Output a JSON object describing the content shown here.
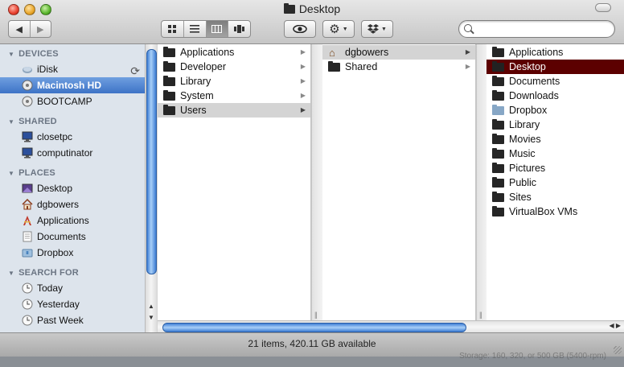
{
  "window": {
    "title": "Desktop"
  },
  "toolbar": {
    "nav": [
      "◀",
      "▶"
    ],
    "views": [
      "icon-view",
      "list-view",
      "column-view",
      "coverflow-view"
    ],
    "search": {
      "value": "",
      "placeholder": ""
    }
  },
  "sidebar": {
    "sections": [
      {
        "title": "DEVICES",
        "items": [
          {
            "label": "iDisk",
            "icon": "idisk-icon"
          },
          {
            "label": "Macintosh HD",
            "icon": "harddisk-icon",
            "selected": true
          },
          {
            "label": "BOOTCAMP",
            "icon": "harddisk-icon"
          }
        ]
      },
      {
        "title": "SHARED",
        "items": [
          {
            "label": "closetpc",
            "icon": "computer-icon"
          },
          {
            "label": "computinator",
            "icon": "computer-icon"
          }
        ]
      },
      {
        "title": "PLACES",
        "items": [
          {
            "label": "Desktop",
            "icon": "desktop-icon"
          },
          {
            "label": "dgbowers",
            "icon": "home-icon"
          },
          {
            "label": "Applications",
            "icon": "applications-icon"
          },
          {
            "label": "Documents",
            "icon": "documents-icon"
          },
          {
            "label": "Dropbox",
            "icon": "dropbox-icon"
          }
        ]
      },
      {
        "title": "SEARCH FOR",
        "items": [
          {
            "label": "Today",
            "icon": "clock-icon"
          },
          {
            "label": "Yesterday",
            "icon": "clock-icon"
          },
          {
            "label": "Past Week",
            "icon": "clock-icon"
          }
        ]
      }
    ]
  },
  "columns": [
    {
      "items": [
        {
          "label": "Applications"
        },
        {
          "label": "Developer"
        },
        {
          "label": "Library"
        },
        {
          "label": "System"
        },
        {
          "label": "Users",
          "state": "highlighted"
        }
      ]
    },
    {
      "items": [
        {
          "label": "dgbowers",
          "state": "highlighted",
          "icon": "home"
        },
        {
          "label": "Shared"
        }
      ]
    },
    {
      "items": [
        {
          "label": "Applications"
        },
        {
          "label": "Desktop",
          "state": "selected"
        },
        {
          "label": "Documents"
        },
        {
          "label": "Downloads"
        },
        {
          "label": "Dropbox",
          "icon": "blue"
        },
        {
          "label": "Library"
        },
        {
          "label": "Movies"
        },
        {
          "label": "Music"
        },
        {
          "label": "Pictures"
        },
        {
          "label": "Public"
        },
        {
          "label": "Sites"
        },
        {
          "label": "VirtualBox VMs"
        }
      ]
    }
  ],
  "status": {
    "text": "21 items, 420.11 GB available"
  },
  "background": {
    "text": "Storage: 160, 320, or 500 GB (5400-rpm)"
  },
  "colors": {
    "sidebar_bg": "#dde4ec",
    "selection": "#3d73c6",
    "selected_row": "#5c0000",
    "highlighted_row": "#d4d4d4"
  }
}
